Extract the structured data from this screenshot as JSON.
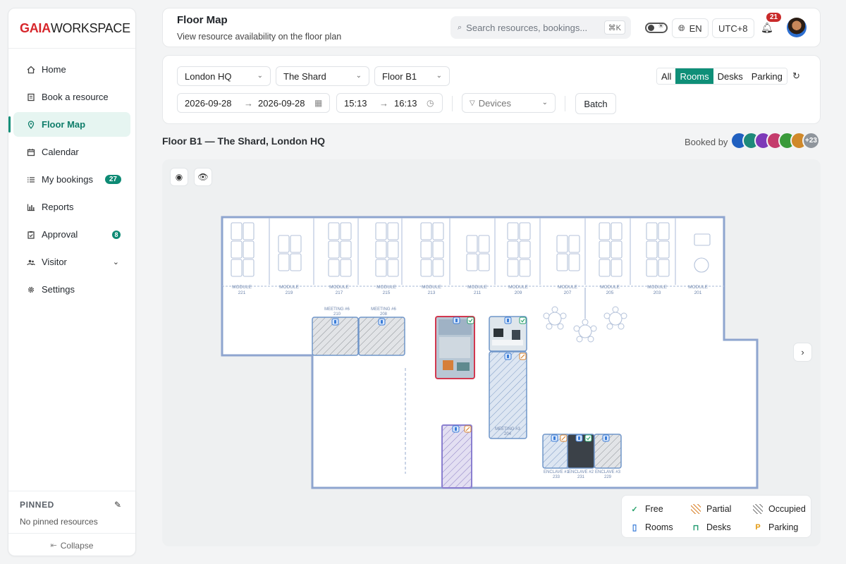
{
  "brand": {
    "part1": "GAIA",
    "part2": "WORKSPACE",
    "accent": "#d7262b"
  },
  "sidebar": {
    "items": [
      {
        "label": "Home",
        "icon": "home-icon"
      },
      {
        "label": "Book a resource",
        "icon": "book-icon"
      },
      {
        "label": "Floor Map",
        "icon": "map-pin-icon",
        "active": true
      },
      {
        "label": "Calendar",
        "icon": "calendar-icon"
      },
      {
        "label": "My bookings",
        "icon": "list-icon",
        "badge": "27"
      },
      {
        "label": "Reports",
        "icon": "bar-chart-icon"
      },
      {
        "label": "Approval",
        "icon": "clipboard-icon",
        "badge": "8"
      },
      {
        "label": "Visitor",
        "icon": "users-icon",
        "expandable": true
      },
      {
        "label": "Settings",
        "icon": "gear-icon"
      }
    ],
    "pinned_title": "PINNED",
    "pinned_empty": "No pinned resources",
    "collapse_label": "Collapse"
  },
  "header": {
    "title": "Floor Map",
    "subtitle": "View resource availability on the floor plan",
    "search_placeholder": "Search resources, bookings...",
    "search_shortcut": "⌘K",
    "language": "EN",
    "timezone": "UTC+8",
    "notifications": "21"
  },
  "filters": {
    "location": "London HQ",
    "building": "The Shard",
    "floor": "Floor B1",
    "date_from": "2026-09-28",
    "date_to": "2026-09-28",
    "time_from": "15:13",
    "time_to": "16:13",
    "devices_placeholder": "Devices",
    "batch_label": "Batch",
    "tabs": [
      "All",
      "Rooms",
      "Desks",
      "Parking"
    ],
    "active_tab": "Rooms"
  },
  "map": {
    "title": "Floor B1 — The Shard, London HQ",
    "booked_by_label": "Booked by",
    "more_count": "+23",
    "modules": [
      {
        "name": "MODULE",
        "num": "221"
      },
      {
        "name": "MODULE",
        "num": "219"
      },
      {
        "name": "MODULE",
        "num": "217"
      },
      {
        "name": "MODULE",
        "num": "215"
      },
      {
        "name": "MODULE",
        "num": "213"
      },
      {
        "name": "MODULE",
        "num": "211"
      },
      {
        "name": "MODULE",
        "num": "209"
      },
      {
        "name": "MODULE",
        "num": "207"
      },
      {
        "name": "MODULE",
        "num": "205"
      },
      {
        "name": "MODULE",
        "num": "203"
      },
      {
        "name": "MODULE",
        "num": "201"
      }
    ],
    "rooms": [
      {
        "name": "MEETING #6",
        "num": "210"
      },
      {
        "name": "MEETING #6",
        "num": "208"
      },
      {
        "name": "MEETING #3",
        "num": "204"
      },
      {
        "name": "ENCLAVE #1",
        "num": "233"
      },
      {
        "name": "ENCLAVE #2",
        "num": "231"
      },
      {
        "name": "ENCLAVE #3",
        "num": "229"
      }
    ]
  },
  "legend": {
    "free": "Free",
    "partial": "Partial",
    "occupied": "Occupied",
    "rooms": "Rooms",
    "desks": "Desks",
    "parking": "Parking"
  },
  "colors": {
    "accent": "#0f8f78",
    "free": "#27a36b",
    "partial": "#d9822b",
    "room_outline": "#6f95c9",
    "occupied_red": "#d2384f",
    "parking": "#e39a12"
  }
}
